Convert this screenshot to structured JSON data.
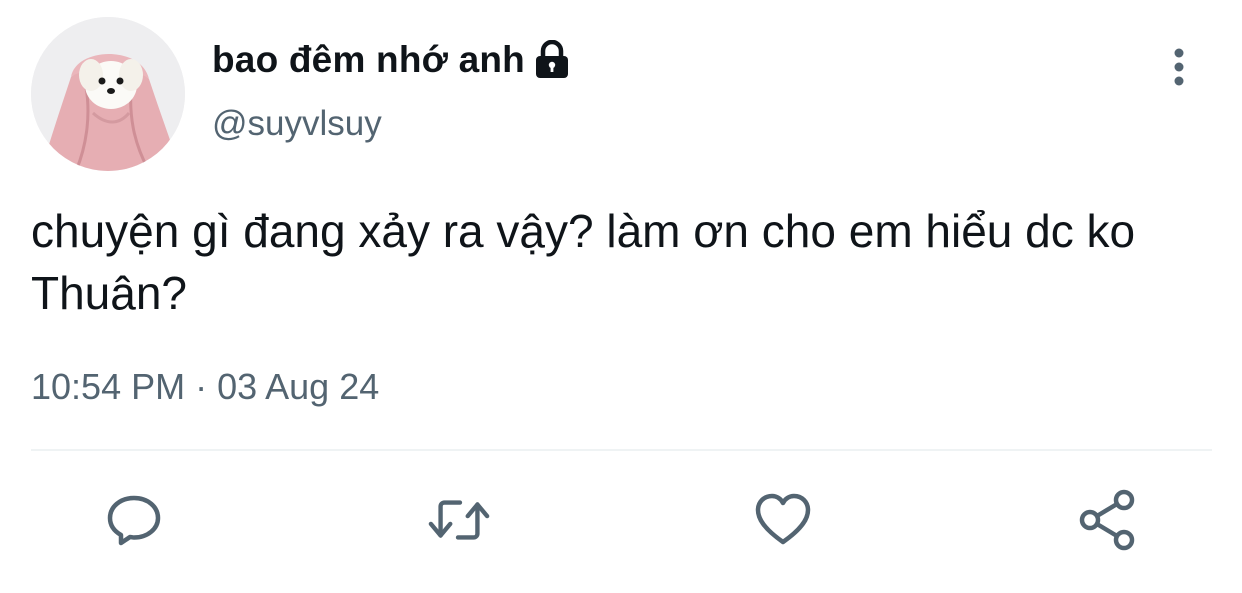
{
  "tweet": {
    "display_name": "bao đêm nhớ anh",
    "handle": "@suyvlsuy",
    "text": "chuyện gì đang xảy ra vậy? làm ơn cho em hiểu dc ko Thuân?",
    "timestamp": "10:54 PM · 03 Aug 24",
    "protected": true
  },
  "icons": {
    "lock": "lock-icon",
    "more": "more-vertical-icon",
    "reply": "reply-icon",
    "retweet": "retweet-icon",
    "like": "heart-icon",
    "share": "share-icon"
  },
  "colors": {
    "text_primary": "#0f1419",
    "text_secondary": "#536471",
    "icon": "#536471",
    "divider": "#eff3f4"
  }
}
